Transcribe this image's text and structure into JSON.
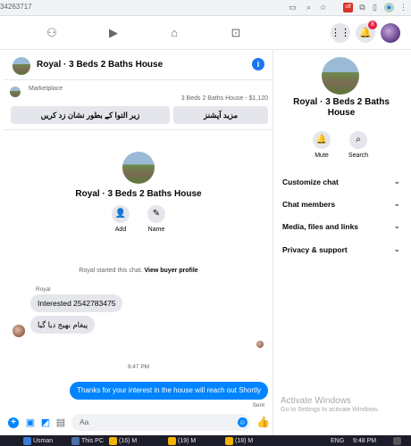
{
  "browser": {
    "url_fragment": "34263717",
    "ext_badge": "off"
  },
  "fb_nav": {
    "notification_count": "8"
  },
  "chat": {
    "header_title": "Royal · 3 Beds 2 Baths House",
    "marketplace_label": "Marketplace",
    "listing_summary": "3 Beds 2 Baths House - $1,120",
    "quick_replies": [
      "زیر التوا کے بطور نشان زد کریں",
      "مزید آپشنز"
    ],
    "center_title": "Royal · 3 Beds 2 Baths House",
    "actions": [
      {
        "label": "Add"
      },
      {
        "label": "Name"
      }
    ],
    "started_text": "Royal started this chat.",
    "buyer_profile_link": "View buyer profile",
    "sender_name": "Royal",
    "incoming_messages": [
      "Interested 2542783475",
      "پیغام بھیج دیا گیا"
    ],
    "timestamp": "9:47 PM",
    "outgoing_message": "Thanks for your interest in the house will reach out Shortly",
    "status": "Sent",
    "composer_placeholder": "Aa"
  },
  "info_panel": {
    "title": "Royal · 3 Beds 2 Baths House",
    "buttons": [
      {
        "label": "Mute"
      },
      {
        "label": "Search"
      }
    ],
    "sections": [
      "Customize chat",
      "Chat members",
      "Media, files and links",
      "Privacy & support"
    ],
    "watermark_title": "Activate Windows",
    "watermark_sub": "Go to Settings to activate Windows."
  },
  "taskbar": {
    "items": [
      "Usman",
      "This PC",
      "(16) M",
      "(19) M",
      "(18) M"
    ],
    "language": "ENG",
    "time": "9:48 PM"
  },
  "colors": {
    "messenger_blue": "#0084ff",
    "fb_blue": "#1877f2",
    "bubble_gray": "#e4e6eb",
    "badge_red": "#e41e3f"
  }
}
